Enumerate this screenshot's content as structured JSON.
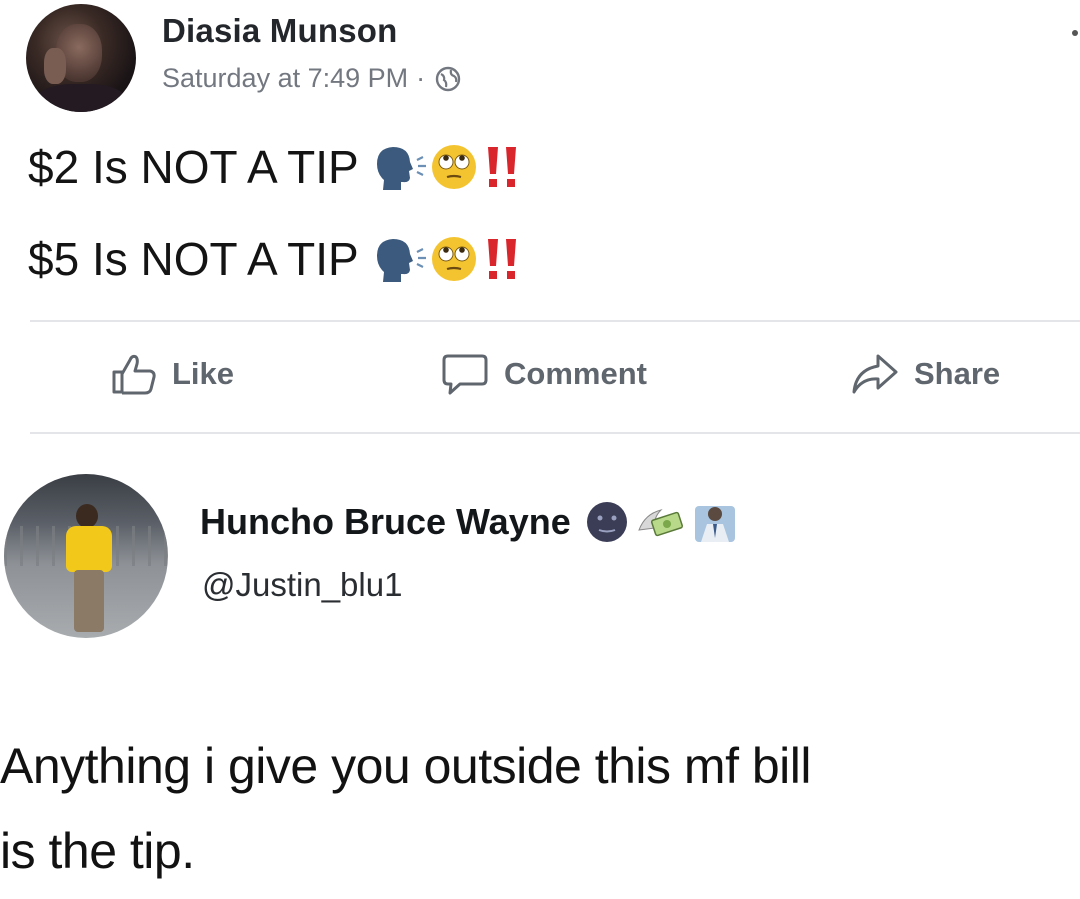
{
  "post": {
    "author_name": "Diasia Munson",
    "timestamp": "Saturday at 7:49 PM",
    "separator": "·",
    "privacy_icon": "globe-icon",
    "lines": [
      {
        "text": "$2 Is NOT A TIP",
        "emojis": [
          "speaking-head-icon",
          "rolling-eyes-icon",
          "double-exclamation-icon"
        ]
      },
      {
        "text": "$5 Is NOT A TIP",
        "emojis": [
          "speaking-head-icon",
          "rolling-eyes-icon",
          "double-exclamation-icon"
        ]
      }
    ],
    "actions": {
      "like_label": "Like",
      "comment_label": "Comment",
      "share_label": "Share"
    }
  },
  "tweet": {
    "author_name": "Huncho Bruce Wayne",
    "name_emojis": [
      "new-moon-face-icon",
      "money-with-wings-icon",
      "businessman-icon"
    ],
    "handle": "@Justin_blu1",
    "text_line_1": "Anything i give you outside this mf bill",
    "text_line_2": "is the tip."
  },
  "colors": {
    "exclamation_red": "#d8262c",
    "meta_gray": "#737880",
    "action_gray": "#60666e",
    "speaking_head_blue": "#3b5a7d",
    "emoji_yellow": "#f4c430"
  }
}
